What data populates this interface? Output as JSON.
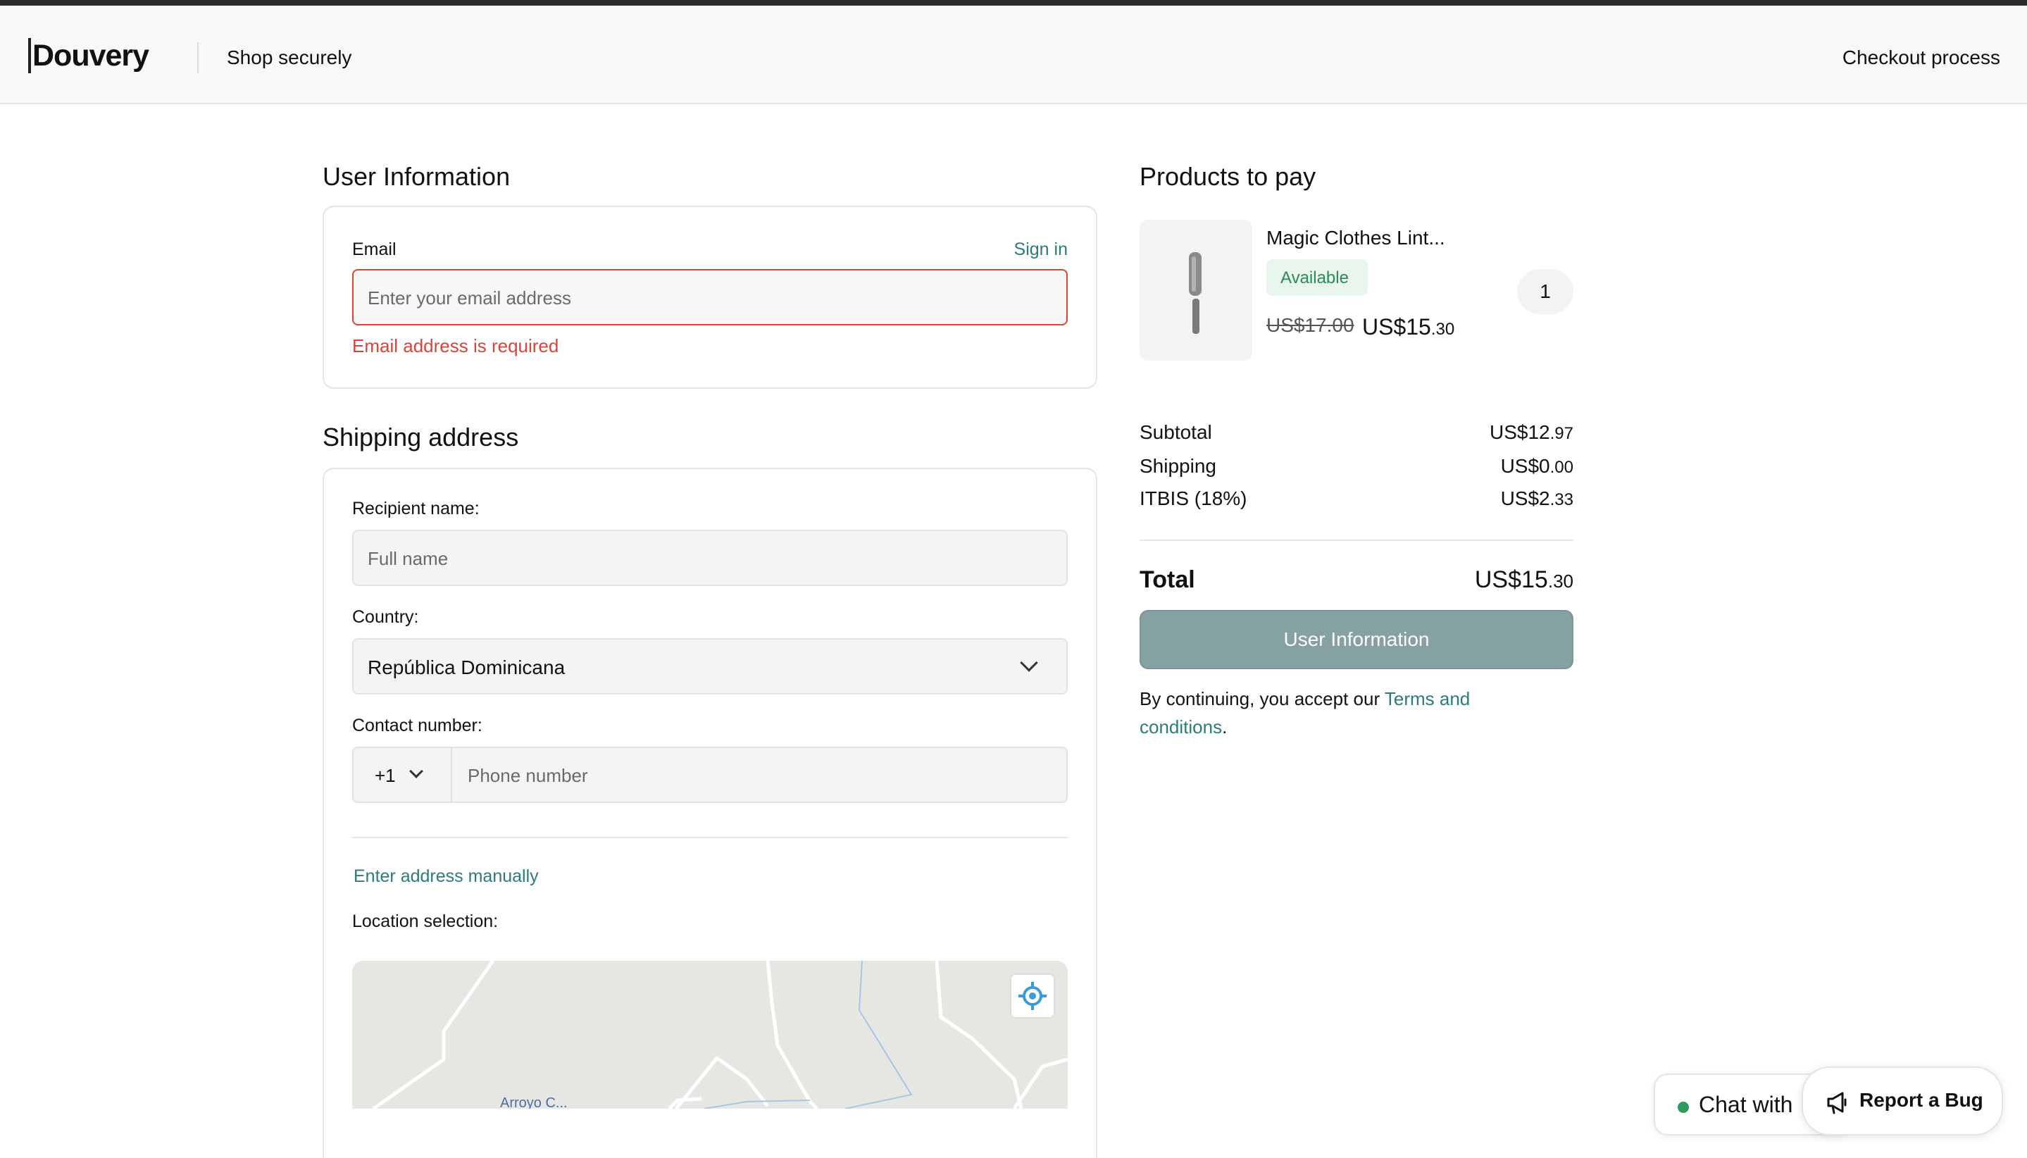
{
  "header": {
    "logo": "Douvery",
    "tagline": "Shop securely",
    "right_text": "Checkout process"
  },
  "user_info": {
    "title": "User Information",
    "email_label": "Email",
    "sign_in": "Sign in",
    "email_placeholder": "Enter your email address",
    "email_error": "Email address is required"
  },
  "shipping": {
    "title": "Shipping address",
    "recipient_label": "Recipient name:",
    "recipient_placeholder": "Full name",
    "country_label": "Country:",
    "country_value": "República Dominicana",
    "contact_label": "Contact number:",
    "phone_code": "+1",
    "phone_placeholder": "Phone number",
    "manual_link": "Enter address manually",
    "location_label": "Location selection:",
    "map_label": "Arroyo C..."
  },
  "products": {
    "title": "Products to pay",
    "items": [
      {
        "name": "Magic Clothes Lint...",
        "status": "Available",
        "old_price": "US$17.00",
        "new_price_main": "US$15",
        "new_price_cents": ".30",
        "quantity": "1"
      }
    ]
  },
  "summary": {
    "subtotal_label": "Subtotal",
    "subtotal_main": "US$12",
    "subtotal_cents": ".97",
    "shipping_label": "Shipping",
    "shipping_main": "US$0",
    "shipping_cents": ".00",
    "tax_label": "ITBIS (18%)",
    "tax_main": "US$2",
    "tax_cents": ".33",
    "total_label": "Total",
    "total_main": "US$15",
    "total_cents": ".30",
    "cta_label": "User Information",
    "terms_prefix": "By continuing, you accept our ",
    "terms_link": "Terms and conditions",
    "terms_suffix": "."
  },
  "floating": {
    "chat_label": "Chat with",
    "bug_label": "Report a Bug"
  },
  "colors": {
    "accent": "#2b7b78",
    "error": "#d8443a",
    "cta_bg": "#85a1a2",
    "available": "#2d8a56"
  },
  "icons": {
    "locate": "crosshair-icon",
    "chevron": "chevron-down-icon",
    "megaphone": "megaphone-icon"
  }
}
